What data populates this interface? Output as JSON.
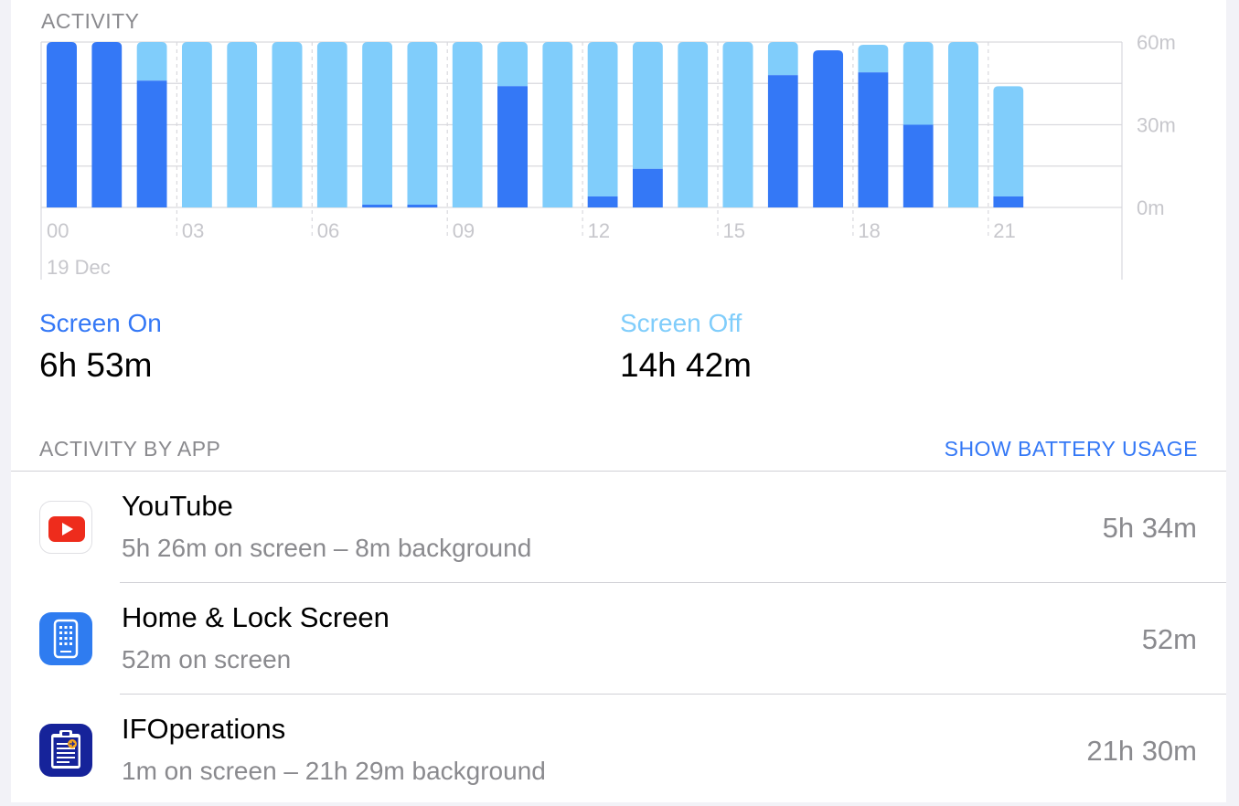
{
  "colors": {
    "screen_on": "#3478f6",
    "screen_off": "#80cdfb",
    "axis_text": "#c7c7cc",
    "grid": "#d9d9de"
  },
  "activity": {
    "title": "ACTIVITY"
  },
  "chart_data": {
    "type": "bar",
    "stacked": true,
    "categories": [
      "00",
      "01",
      "02",
      "03",
      "04",
      "05",
      "06",
      "07",
      "08",
      "09",
      "10",
      "11",
      "12",
      "13",
      "14",
      "15",
      "16",
      "17",
      "18",
      "19",
      "20",
      "21"
    ],
    "x_tick_labels": [
      "00",
      "03",
      "06",
      "09",
      "12",
      "15",
      "18",
      "21"
    ],
    "date_label": "19 Dec",
    "y_tick_labels": [
      "60m",
      "30m",
      "0m"
    ],
    "ylim": [
      0,
      60
    ],
    "ylabel": "",
    "xlabel": "",
    "grid": true,
    "series": [
      {
        "name": "Screen On",
        "color": "#3478f6",
        "values": [
          60,
          60,
          46,
          0,
          0,
          0,
          0,
          1,
          1,
          0,
          44,
          0,
          4,
          14,
          0,
          0,
          48,
          57,
          49,
          30,
          0,
          4
        ]
      },
      {
        "name": "Screen Off",
        "color": "#80cdfb",
        "values": [
          0,
          0,
          14,
          60,
          60,
          60,
          60,
          59,
          59,
          60,
          16,
          60,
          56,
          46,
          60,
          60,
          12,
          0,
          10,
          30,
          60,
          40
        ]
      }
    ]
  },
  "summary": {
    "screen_on_label": "Screen On",
    "screen_on_value": "6h 53m",
    "screen_off_label": "Screen Off",
    "screen_off_value": "14h 42m"
  },
  "activity_by_app": {
    "title": "ACTIVITY BY APP",
    "show_battery_label": "SHOW BATTERY USAGE",
    "apps": [
      {
        "name": "YouTube",
        "detail": "5h 26m on screen – 8m background",
        "total": "5h 34m",
        "icon": "youtube-icon"
      },
      {
        "name": "Home & Lock Screen",
        "detail": "52m on screen",
        "total": "52m",
        "icon": "home-lock-screen-icon"
      },
      {
        "name": "IFOperations",
        "detail": "1m on screen – 21h 29m background",
        "total": "21h 30m",
        "icon": "ifoperations-icon"
      }
    ]
  }
}
